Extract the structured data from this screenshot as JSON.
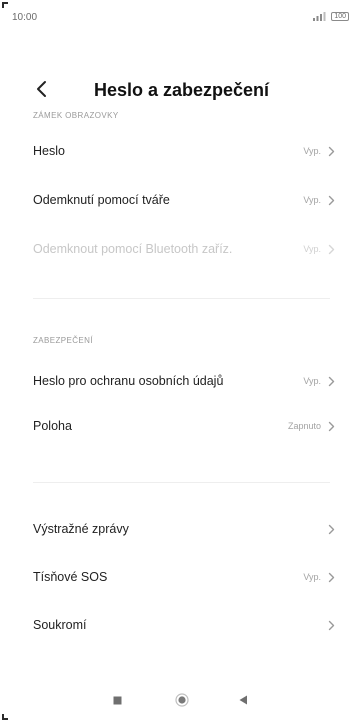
{
  "status_bar": {
    "time": "10:00",
    "battery": "100"
  },
  "header": {
    "title": "Heslo a zabezpečení"
  },
  "sections": [
    {
      "header": "ZÁMEK OBRAZOVKY",
      "items": [
        {
          "label": "Heslo",
          "value": "Vyp.",
          "enabled": true
        },
        {
          "label": "Odemknutí pomocí tváře",
          "value": "Vyp.",
          "enabled": true
        },
        {
          "label": "Odemknout pomocí Bluetooth zaříz.",
          "value": "Vyp.",
          "enabled": false
        }
      ]
    },
    {
      "header": "ZABEZPEČENÍ",
      "items": [
        {
          "label": "Heslo pro ochranu osobních údajů",
          "value": "Vyp.",
          "enabled": true
        },
        {
          "label": "Poloha",
          "value": "Zapnuto",
          "enabled": true
        }
      ]
    },
    {
      "header": "",
      "items": [
        {
          "label": "Výstražné zprávy",
          "value": "",
          "enabled": true
        },
        {
          "label": "Tísňové SOS",
          "value": "Vyp.",
          "enabled": true
        },
        {
          "label": "Soukromí",
          "value": "",
          "enabled": true
        }
      ]
    }
  ]
}
